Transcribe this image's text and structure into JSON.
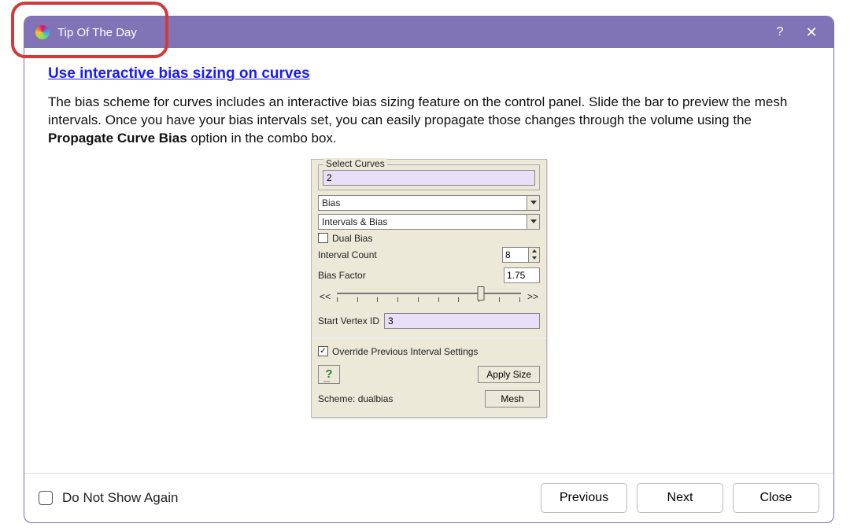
{
  "window": {
    "title": "Tip Of The Day",
    "help_btn": "?",
    "close_btn": "✕"
  },
  "tip": {
    "title": "Use interactive bias sizing on curves",
    "body_1": "The bias scheme for curves includes an interactive bias sizing feature on the control panel. Slide the bar to preview the mesh intervals. Once you have your bias intervals set, you can easily propagate those changes through the volume using the ",
    "body_bold": "Propagate Curve Bias",
    "body_2": " option in the combo box."
  },
  "panel": {
    "select_curves_label": "Select Curves",
    "select_curves_value": "2",
    "dropdown1_value": "Bias",
    "dropdown2_value": "Intervals & Bias",
    "dual_bias_label": "Dual Bias",
    "dual_bias_checked": false,
    "interval_count_label": "Interval Count",
    "interval_count_value": "8",
    "bias_factor_label": "Bias Factor",
    "bias_factor_value": "1.75",
    "slider_left": "<<",
    "slider_right": ">>",
    "slider_pos_pct": 78,
    "start_vertex_label": "Start Vertex ID",
    "start_vertex_value": "3",
    "override_label": "Override Previous Interval Settings",
    "override_checked": true,
    "apply_size_label": "Apply Size",
    "mesh_label": "Mesh",
    "scheme_label": "Scheme: dualbias"
  },
  "footer": {
    "do_not_show_label": "Do Not Show Again",
    "previous": "Previous",
    "next": "Next",
    "close": "Close"
  }
}
